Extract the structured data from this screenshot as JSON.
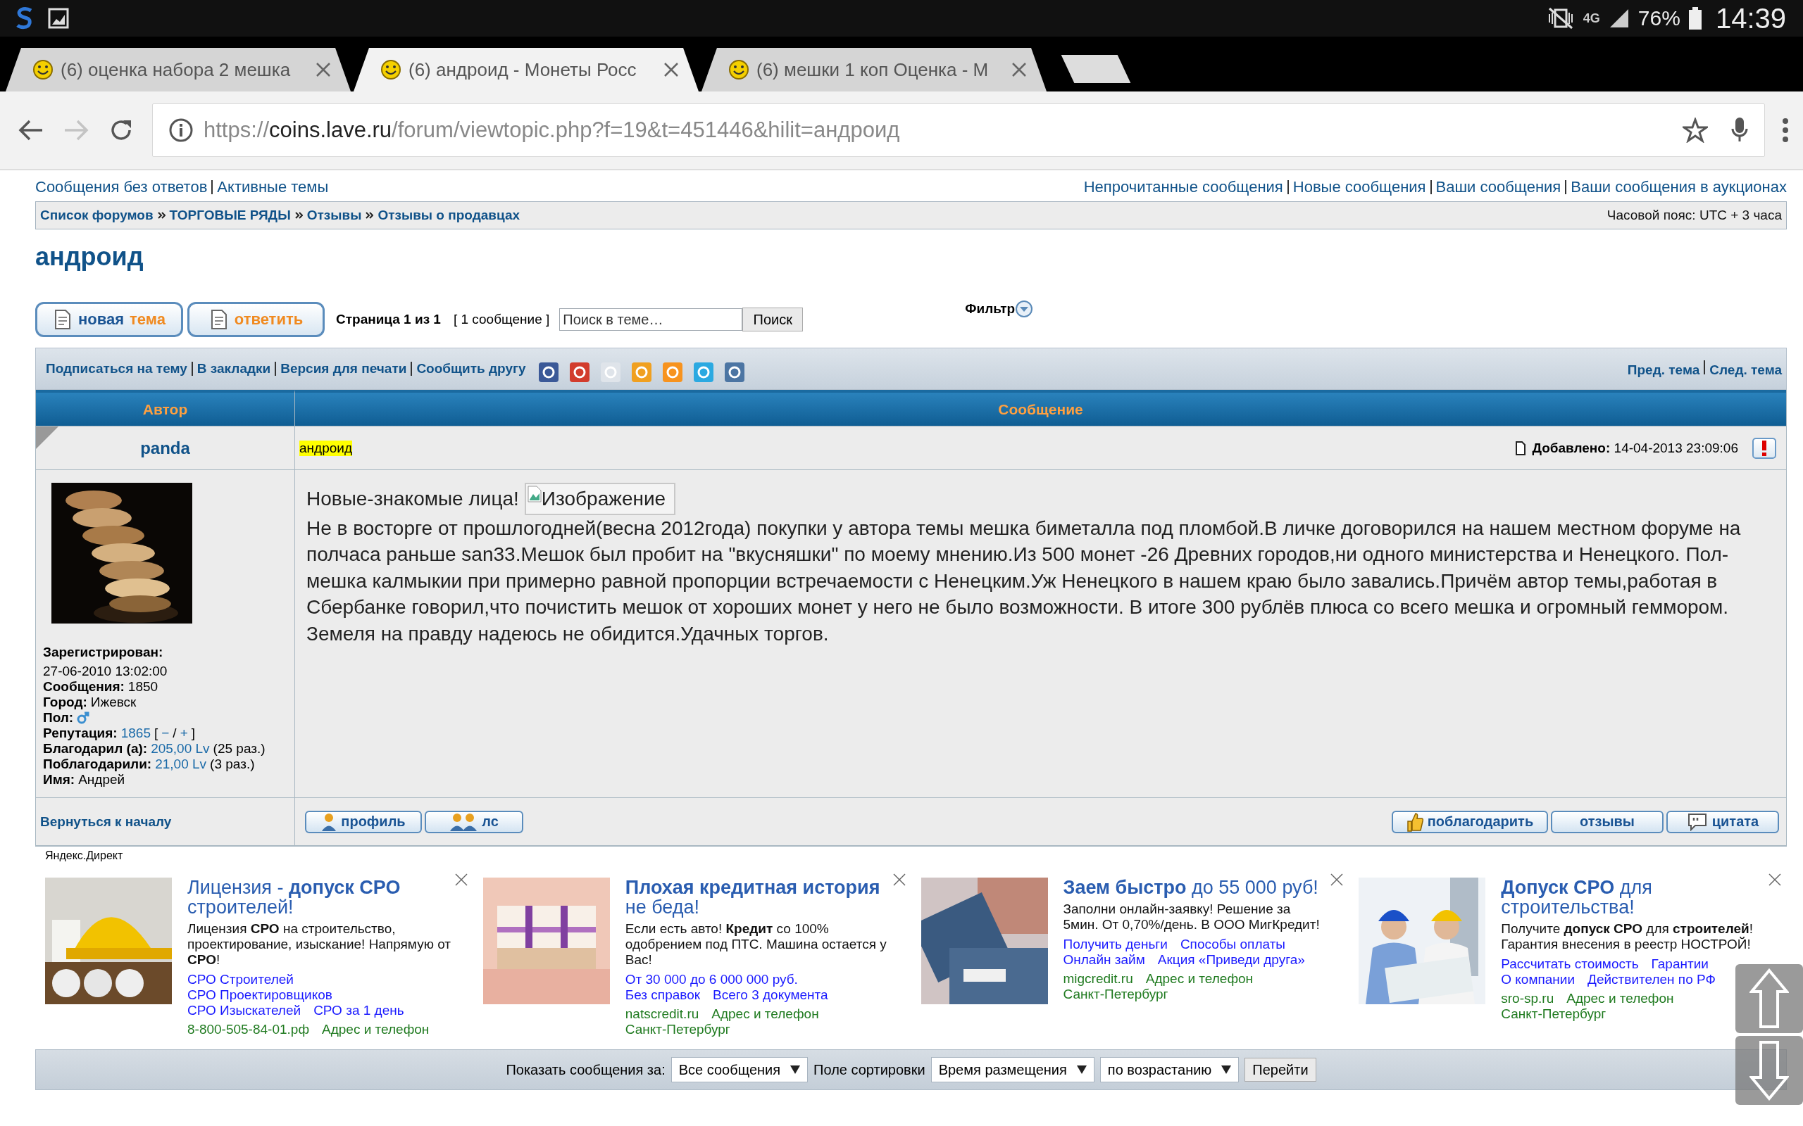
{
  "status_bar": {
    "network": "4G",
    "battery": "76%",
    "time": "14:39"
  },
  "browser": {
    "tabs": [
      {
        "title": "(6) оценка набора 2 мешка",
        "selected": false
      },
      {
        "title": "(6) андроид - Монеты Росс",
        "selected": true
      },
      {
        "title": "(6) мешки 1 коп Оценка - М",
        "selected": false
      }
    ],
    "url": {
      "scheme": "https://",
      "host": "coins.lave.ru",
      "path": "/forum/viewtopic.php?f=19&t=451446&hilit=андроид"
    }
  },
  "top_links": {
    "left": [
      "Сообщения без ответов",
      "Активные темы"
    ],
    "right": [
      "Непрочитанные сообщения",
      "Новые сообщения",
      "Ваши сообщения",
      "Ваши сообщения в аукционах"
    ]
  },
  "breadcrumbs": [
    "Список форумов",
    "ТОРГОВЫЕ РЯДЫ",
    "Отзывы",
    "Отзывы о продавцах"
  ],
  "timezone": "Часовой пояс: UTC + 3 часа",
  "topic_title": "андроид",
  "action_buttons": [
    {
      "parts": [
        "новая",
        "тема"
      ]
    },
    {
      "parts": [
        "ответить"
      ]
    }
  ],
  "pagination": "Страница 1 из 1",
  "post_count": "[ 1 сообщение ]",
  "search": {
    "placeholder": "Поиск в теме…",
    "button": "Поиск"
  },
  "filter": "Фильтр",
  "topic_tools": [
    "Подписаться на тему",
    "В закладки",
    "Версия для печати",
    "Сообщить другу"
  ],
  "share_icons": [
    {
      "color": "#3b5998"
    },
    {
      "color": "#d23c2c"
    },
    {
      "color": "#dfe4ea"
    },
    {
      "color": "#f0a020"
    },
    {
      "color": "#f7931e"
    },
    {
      "color": "#2ba9e1"
    },
    {
      "color": "#4c75a3"
    }
  ],
  "topic_nav": [
    "Пред. тема",
    "След. тема"
  ],
  "table": {
    "columns": [
      "Автор",
      "Сообщение"
    ]
  },
  "post": {
    "author": "panda",
    "subject": "андроид",
    "highlighted": true,
    "added_label": "Добавлено:",
    "added": "14-04-2013 23:09:06",
    "profile": [
      {
        "label": "Зарегистрирован:",
        "kind": "text",
        "parts": [
          {
            "text": "27-06-2010 13:02:00",
            "kind": "text"
          }
        ]
      },
      {
        "label": "Сообщения:",
        "kind": "text",
        "parts": [
          {
            "text": "1850",
            "kind": "text"
          }
        ]
      },
      {
        "label": "Город:",
        "kind": "text",
        "parts": [
          {
            "text": "Ижевск",
            "kind": "text"
          }
        ]
      },
      {
        "label": "Пол:",
        "kind": "gender"
      },
      {
        "label": "Репутация:",
        "kind": "text",
        "parts": [
          {
            "text": "1865",
            "kind": "link"
          },
          {
            "text": "[",
            "kind": "text"
          },
          {
            "text": "−",
            "kind": "link"
          },
          {
            "text": "/",
            "kind": "text"
          },
          {
            "text": "+",
            "kind": "link"
          },
          {
            "text": "]",
            "kind": "text"
          }
        ]
      },
      {
        "label": "Благодарил (а):",
        "kind": "text",
        "parts": [
          {
            "text": "205,00 Lv",
            "kind": "link"
          },
          {
            "text": "(25 раз.)",
            "kind": "text"
          }
        ]
      },
      {
        "label": "Поблагодарили:",
        "kind": "text",
        "parts": [
          {
            "text": "21,00 Lv",
            "kind": "link"
          },
          {
            "text": "(3 раз.)",
            "kind": "text"
          }
        ]
      },
      {
        "label": "Имя:",
        "kind": "text",
        "parts": [
          {
            "text": "Андрей",
            "kind": "text"
          }
        ]
      }
    ],
    "lead": "Новые-знакомые лица!",
    "image_alt": "Изображение",
    "paragraphs": [
      "Не в восторге от прошлогодней(весна 2012года) покупки у автора темы мешка биметалла под пломбой.В личке договорился на нашем местном форуме на полчаса раньше san33.Мешок был пробит на \"вкусняшки\" по моему мнению.Из 500 монет -26 Древних городов,ни одного министерства и Ненецкого. Пол-мешка калмыкии при примерно равной пропорции встречаемости с Ненецким.Уж Ненецкого в нашем краю было завались.Причём автор темы,работая в Сбербанке говорил,что почистить мешок от хороших монет у него не было возможности. В итоге 300 рублёв плюса со всего мешка и огромный геммором.",
      "Земеля на правду надеюсь не обидится.Удачных торгов."
    ],
    "back_to_top": "Вернуться к началу",
    "left_buttons": [
      "профиль",
      "лс"
    ],
    "right_buttons": [
      "поблагодарить",
      "отзывы",
      "цитата"
    ]
  },
  "ads_label": "Яндекс.Директ",
  "ads": [
    {
      "title": "Лицензия - **допуск СРО** строителей!",
      "text": "Лицензия **СРО** на строительство, проектирование, изыскание! Напрямую от **СРО**!",
      "links": [
        [
          "СРО Строителей"
        ],
        [
          "СРО Проектировщиков"
        ],
        [
          "СРО Изыскателей",
          "СРО за 1 день"
        ]
      ],
      "contacts": [
        [
          "8-800-505-84-01.рф",
          "Адрес и телефон"
        ]
      ]
    },
    {
      "title": "**Плохая кредитная история** не беда!",
      "text": "Если есть авто! **Кредит** со 100% одобрением под ПТС. Машина остается у Вас!",
      "links": [
        [
          "От 30 000 до 6 000 000 руб."
        ],
        [
          "Без справок",
          "Всего 3 документа"
        ]
      ],
      "contacts": [
        [
          "natscredit.ru",
          "Адрес и телефон"
        ],
        [
          "Санкт-Петербург"
        ]
      ]
    },
    {
      "title": "**Заем быстро** до 55 000 руб!",
      "text": "Заполни онлайн-заявку! Решение за 5мин. От 0,70%/день. В ООО МигКредит!",
      "links": [
        [
          "Получить деньги",
          "Способы оплаты"
        ],
        [
          "Онлайн займ",
          "Акция «Приведи друга»"
        ]
      ],
      "contacts": [
        [
          "migcredit.ru",
          "Адрес и телефон"
        ],
        [
          "Санкт-Петербург"
        ]
      ]
    },
    {
      "title": "**Допуск СРО** для строительства!",
      "text": "Получите **допуск СРО** для **строителей**! Гарантия внесения в реестр НОСТРОЙ!",
      "links": [
        [
          "Рассчитать стоимость",
          "Гарантии"
        ],
        [
          "О компании",
          "Действителен по РФ"
        ]
      ],
      "contacts": [
        [
          "sro-sp.ru",
          "Адрес и телефон"
        ],
        [
          "Санкт-Петербург"
        ]
      ]
    }
  ],
  "sort_bar": {
    "show_label": "Показать сообщения за:",
    "show_value": "Все сообщения",
    "sort_label": "Поле сортировки",
    "sort_value": "Время размещения",
    "order_value": "по возрастанию",
    "go_button": "Перейти"
  }
}
